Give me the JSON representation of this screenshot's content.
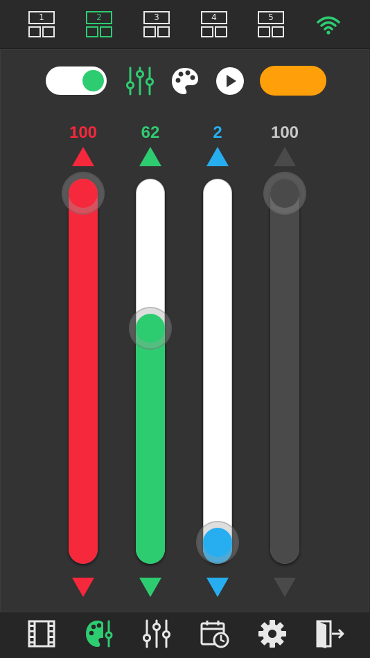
{
  "layouts": [
    {
      "label": "1",
      "active": false
    },
    {
      "label": "2",
      "active": true
    },
    {
      "label": "3",
      "active": false
    },
    {
      "label": "4",
      "active": false
    },
    {
      "label": "5",
      "active": false
    }
  ],
  "status": {
    "icon": "wifi-icon",
    "color": "#2ecc71"
  },
  "controls": {
    "power_toggle_on": true,
    "icons": [
      "sliders-icon",
      "palette-icon",
      "play-icon"
    ],
    "current_color": "#ff9f0a"
  },
  "sliders": [
    {
      "channel": "red",
      "value": "100",
      "level": 100,
      "color": "#f5283c"
    },
    {
      "channel": "green",
      "value": "62",
      "level": 62,
      "color": "#2ecc71"
    },
    {
      "channel": "blue",
      "value": "2",
      "level": 2,
      "color": "#26aef0"
    },
    {
      "channel": "white",
      "value": "100",
      "level": 100,
      "color": "#4a4a4a"
    }
  ],
  "value_colors": [
    "#f5283c",
    "#2ecc71",
    "#26aef0",
    "#c8c8c8"
  ],
  "nav": [
    {
      "icon": "film-icon",
      "active": false
    },
    {
      "icon": "palette-icon",
      "active": true
    },
    {
      "icon": "sliders-icon",
      "active": false
    },
    {
      "icon": "calendar-clock-icon",
      "active": false
    },
    {
      "icon": "gear-icon",
      "active": false
    },
    {
      "icon": "exit-icon",
      "active": false
    }
  ]
}
